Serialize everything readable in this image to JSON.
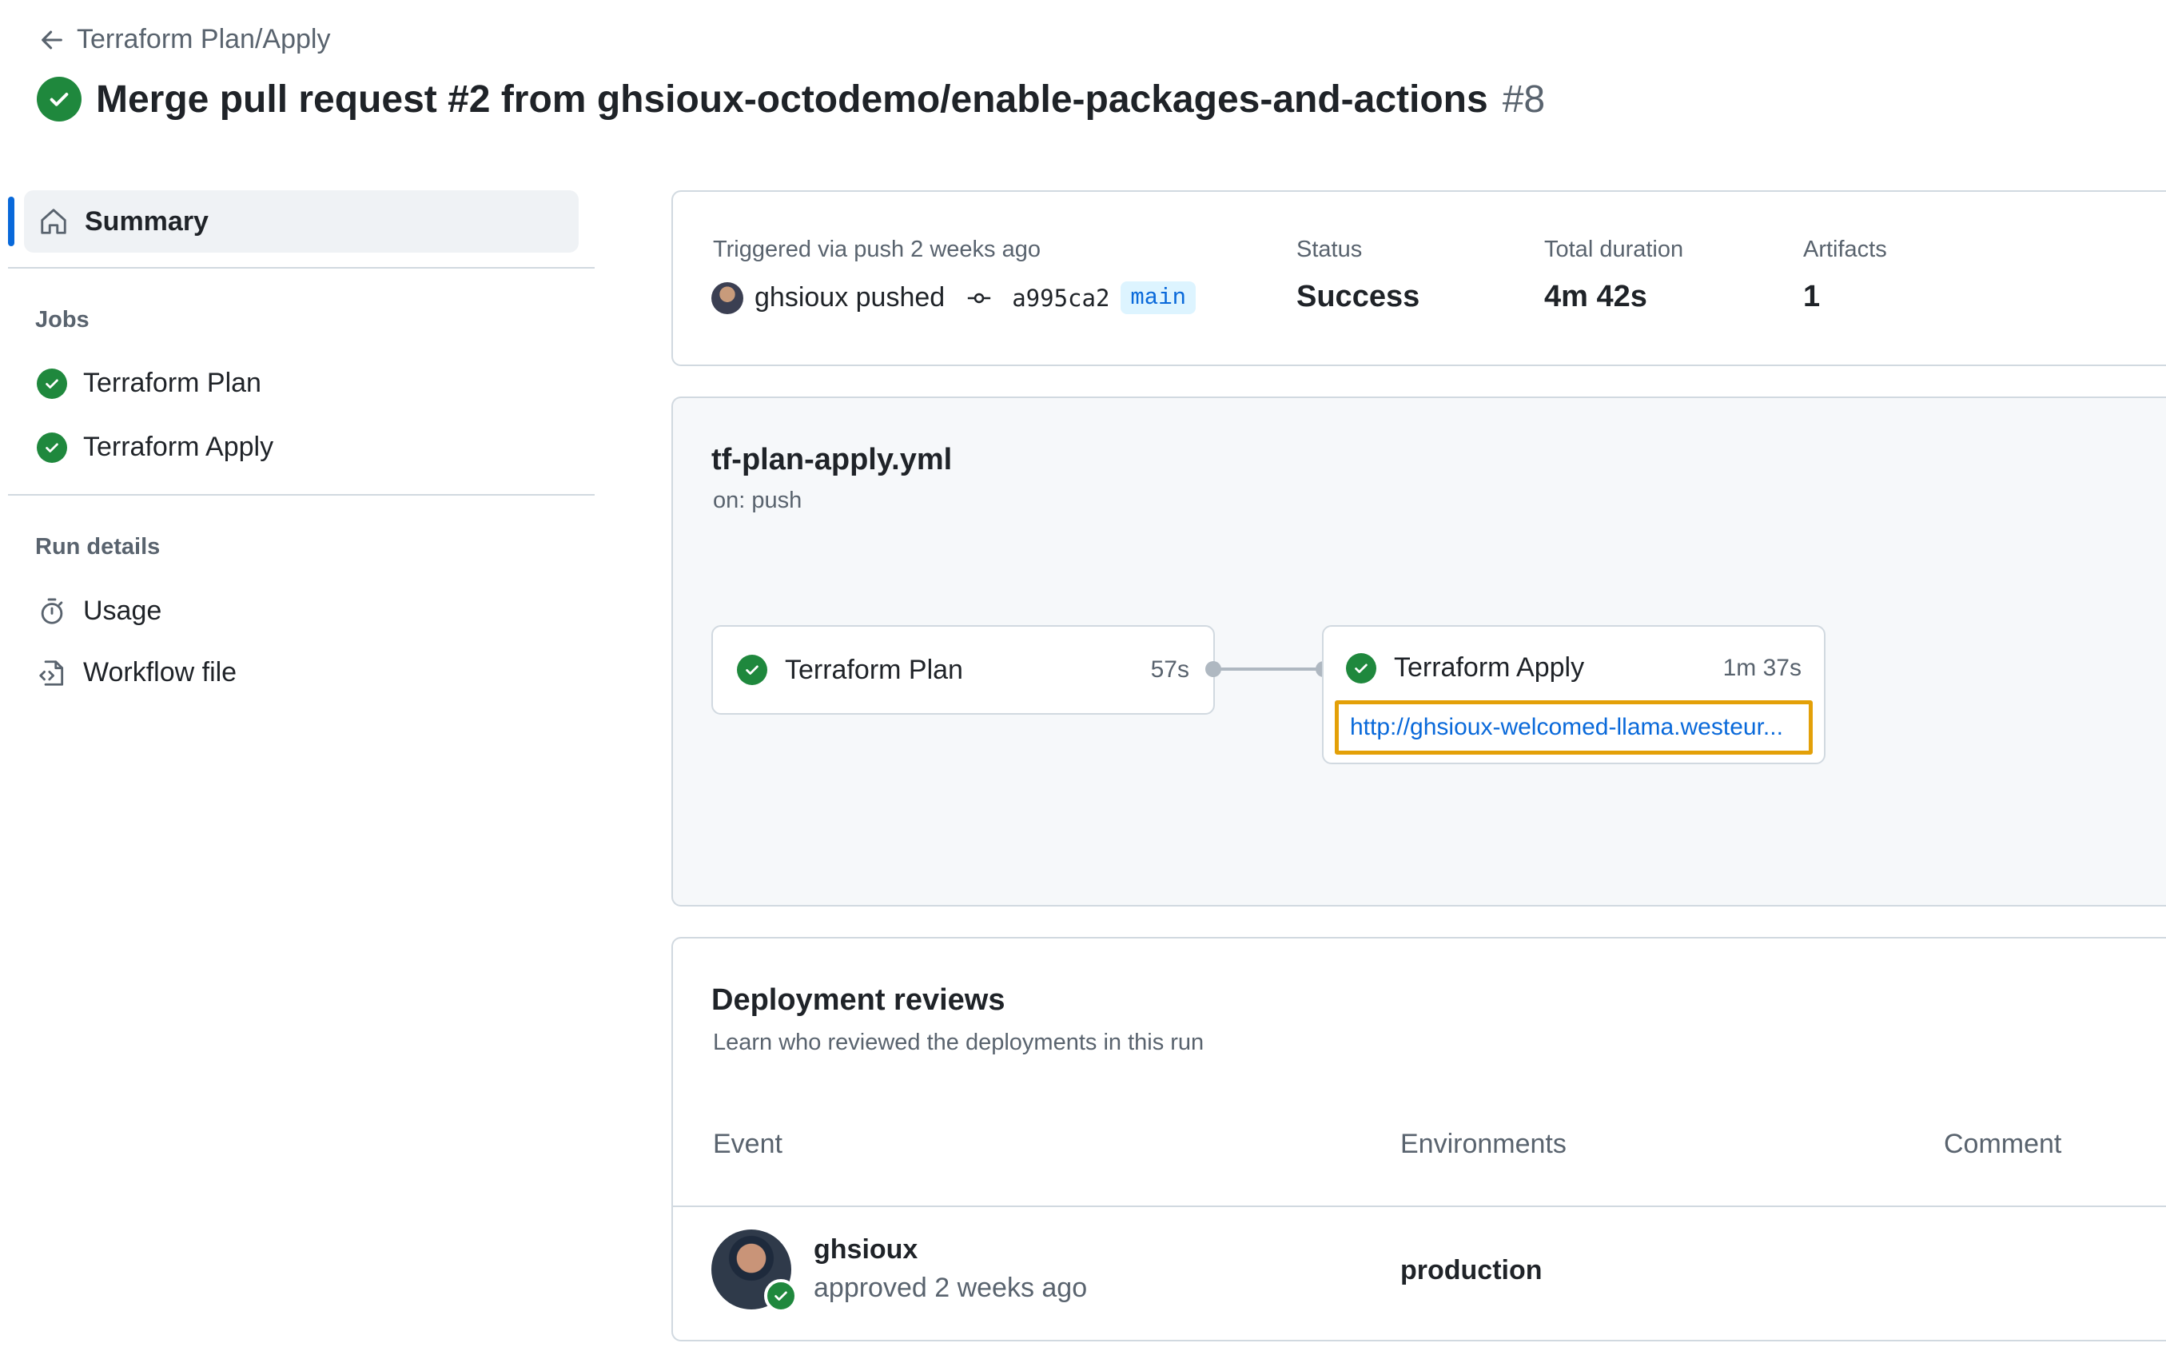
{
  "header": {
    "breadcrumb": "Terraform Plan/Apply",
    "title": "Merge pull request #2 from ghsioux-octodemo/enable-packages-and-actions",
    "run_number": "#8"
  },
  "sidebar": {
    "summary_label": "Summary",
    "jobs_heading": "Jobs",
    "jobs": [
      {
        "label": "Terraform Plan",
        "status": "success"
      },
      {
        "label": "Terraform Apply",
        "status": "success"
      }
    ],
    "run_details_heading": "Run details",
    "run_details": [
      {
        "label": "Usage",
        "icon": "stopwatch-icon"
      },
      {
        "label": "Workflow file",
        "icon": "file-code-icon"
      }
    ]
  },
  "summary": {
    "trigger_text": "Triggered via push 2 weeks ago",
    "actor": "ghsioux pushed",
    "commit_sha": "a995ca2",
    "branch": "main",
    "status_label": "Status",
    "status_value": "Success",
    "duration_label": "Total duration",
    "duration_value": "4m 42s",
    "artifacts_label": "Artifacts",
    "artifacts_value": "1"
  },
  "workflow": {
    "file": "tf-plan-apply.yml",
    "trigger": "on: push",
    "jobs": [
      {
        "name": "Terraform Plan",
        "duration": "57s"
      },
      {
        "name": "Terraform Apply",
        "duration": "1m 37s",
        "url": "http://ghsioux-welcomed-llama.westeur..."
      }
    ]
  },
  "reviews": {
    "title": "Deployment reviews",
    "subtitle": "Learn who reviewed the deployments in this run",
    "columns": [
      "Event",
      "Environments",
      "Comment"
    ],
    "rows": [
      {
        "user": "ghsioux",
        "action": "approved 2 weeks ago",
        "environment": "production",
        "comment": ""
      }
    ]
  },
  "colors": {
    "success": "#1f883d",
    "accent": "#0969da",
    "highlight_border": "#e3a008"
  }
}
